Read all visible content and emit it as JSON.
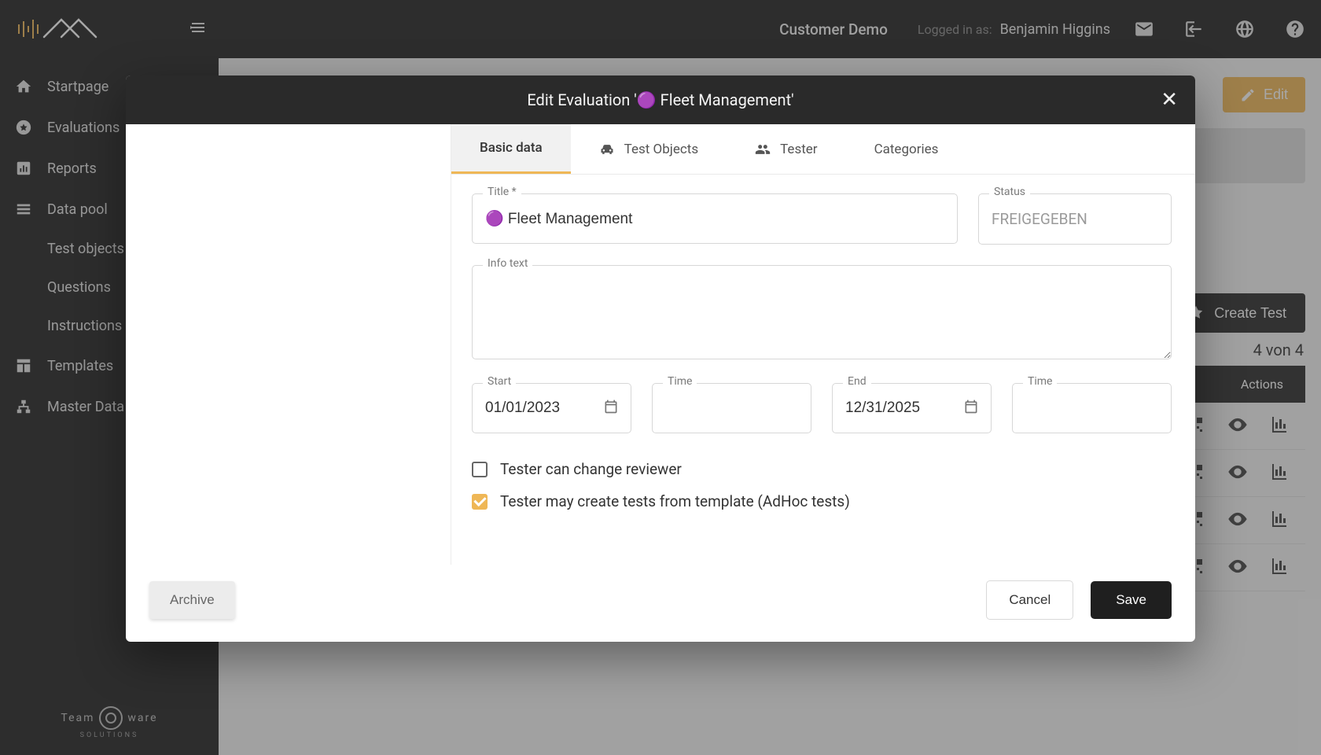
{
  "topbar": {
    "customer": "Customer Demo",
    "logged_in_as_label": "Logged in as:",
    "username": "Benjamin Higgins"
  },
  "sidebar": {
    "items": [
      {
        "label": "Startpage",
        "icon": "home-icon"
      },
      {
        "label": "Evaluations",
        "icon": "star-circle-icon"
      },
      {
        "label": "Reports",
        "icon": "bar-chart-icon"
      },
      {
        "label": "Data pool",
        "icon": "list-icon"
      },
      {
        "label": "Test objects",
        "sub": true
      },
      {
        "label": "Questions",
        "sub": true
      },
      {
        "label": "Instructions",
        "sub": true
      },
      {
        "label": "Templates",
        "icon": "template-icon"
      },
      {
        "label": "Master Data",
        "icon": "tree-icon"
      }
    ],
    "footer_brand": "Team",
    "footer_brand2": "ware",
    "footer_tag": "SOLUTIONS"
  },
  "page": {
    "edit_label": "Edit",
    "create_test_label": "Create Test",
    "count_text": "4 von 4",
    "actions_header": "Actions"
  },
  "modal": {
    "title": "Edit Evaluation '🟣 Fleet Management'",
    "tabs": {
      "basic": "Basic data",
      "test_objects": "Test Objects",
      "tester": "Tester",
      "categories": "Categories"
    },
    "fields": {
      "title_label": "Title *",
      "title_value": "🟣 Fleet Management",
      "status_label": "Status",
      "status_value": "FREIGEGEBEN",
      "info_label": "Info text",
      "info_value": "",
      "start_label": "Start",
      "start_value": "01/01/2023",
      "start_time_label": "Time",
      "start_time_value": "",
      "end_label": "End",
      "end_value": "12/31/2025",
      "end_time_label": "Time",
      "end_time_value": ""
    },
    "checks": {
      "change_reviewer": "Tester can change reviewer",
      "change_reviewer_checked": false,
      "adhoc": "Tester may create tests from template (AdHoc tests)",
      "adhoc_checked": true
    },
    "buttons": {
      "archive": "Archive",
      "cancel": "Cancel",
      "save": "Save"
    }
  }
}
